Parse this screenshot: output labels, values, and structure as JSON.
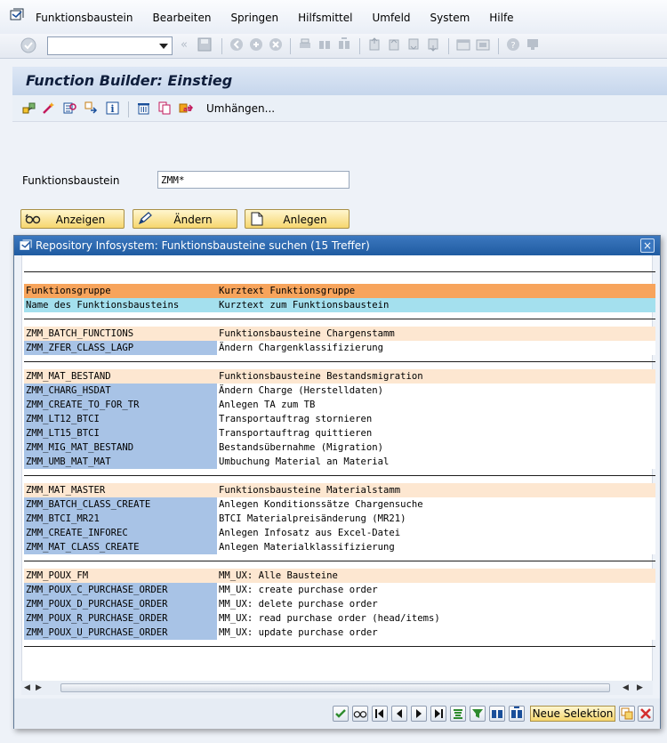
{
  "menu": {
    "items": [
      {
        "label": "Funktionsbaustein"
      },
      {
        "label": "Bearbeiten"
      },
      {
        "label": "Springen"
      },
      {
        "label": "Hilfsmittel"
      },
      {
        "label": "Umfeld"
      },
      {
        "label": "System"
      },
      {
        "label": "Hilfe"
      }
    ]
  },
  "command_field": {
    "value": ""
  },
  "title": "Function Builder: Einstieg",
  "app_toolbar": {
    "umhaengen_label": "Umhängen..."
  },
  "form": {
    "label": "Funktionsbaustein",
    "value": "ZMM*"
  },
  "buttons": {
    "anzeigen": "Anzeigen",
    "aendern": "Ändern",
    "anlegen": "Anlegen"
  },
  "dialog": {
    "title": "Repository Infosystem: Funktionsbausteine suchen (15 Treffer)",
    "close": "×",
    "header_rows": [
      {
        "c1": "Funktionsgruppe",
        "c2": "Kurztext Funktionsgruppe"
      },
      {
        "c1": "Name des Funktionsbausteins",
        "c2": "Kurztext zum Funktionsbaustein"
      }
    ],
    "groups": [
      {
        "name": "ZMM_BATCH_FUNCTIONS",
        "text": "Funktionsbausteine Chargenstamm",
        "items": [
          {
            "name": "ZMM_ZFER_CLASS_LAGP",
            "text": "Ändern Chargenklassifizierung"
          }
        ]
      },
      {
        "name": "ZMM_MAT_BESTAND",
        "text": "Funktionsbausteine Bestandsmigration",
        "items": [
          {
            "name": "ZMM_CHARG_HSDAT",
            "text": "Ändern Charge (Herstelldaten)"
          },
          {
            "name": "ZMM_CREATE_TO_FOR_TR",
            "text": "Anlegen TA zum TB"
          },
          {
            "name": "ZMM_LT12_BTCI",
            "text": "Transportauftrag stornieren"
          },
          {
            "name": "ZMM_LT15_BTCI",
            "text": "Transportauftrag quittieren"
          },
          {
            "name": "ZMM_MIG_MAT_BESTAND",
            "text": "Bestandsübernahme (Migration)"
          },
          {
            "name": "ZMM_UMB_MAT_MAT",
            "text": "Umbuchung Material an Material"
          }
        ]
      },
      {
        "name": "ZMM_MAT_MASTER",
        "text": "Funktionsbausteine Materialstamm",
        "items": [
          {
            "name": "ZMM_BATCH_CLASS_CREATE",
            "text": "Anlegen Konditionssätze Chargensuche"
          },
          {
            "name": "ZMM_BTCI_MR21",
            "text": "BTCI Materialpreisänderung (MR21)"
          },
          {
            "name": "ZMM_CREATE_INFOREC",
            "text": "Anlegen Infosatz aus Excel-Datei"
          },
          {
            "name": "ZMM_MAT_CLASS_CREATE",
            "text": "Anlegen Materialklassifizierung"
          }
        ]
      },
      {
        "name": "ZMM_POUX_FM",
        "text": "MM_UX: Alle Bausteine",
        "items": [
          {
            "name": "ZMM_POUX_C_PURCHASE_ORDER",
            "text": "MM_UX: create purchase order"
          },
          {
            "name": "ZMM_POUX_D_PURCHASE_ORDER",
            "text": "MM_UX: delete purchase order"
          },
          {
            "name": "ZMM_POUX_R_PURCHASE_ORDER",
            "text": "MM_UX: read purchase order (head/items)"
          },
          {
            "name": "ZMM_POUX_U_PURCHASE_ORDER",
            "text": "MM_UX: update purchase order"
          }
        ]
      }
    ],
    "footer": {
      "neue_selektion": "Neue Selektion"
    }
  },
  "colors": {
    "header_orange": "#f7a45c",
    "header_cyan": "#a4e0ee",
    "group_row": "#fde7d1",
    "item_name": "#a8c3e6",
    "dialog_title": "#1f5ba1",
    "button_yellow": "#f6d66e"
  }
}
